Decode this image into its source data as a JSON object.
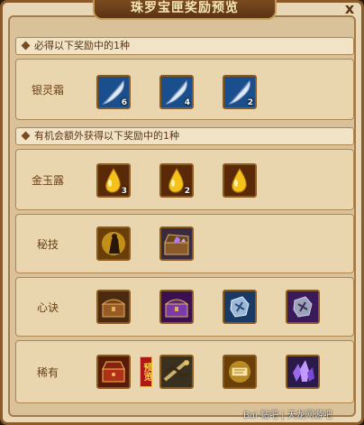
{
  "window": {
    "title": "珠罗宝匣奖励预览",
    "close_glyph": "x"
  },
  "sections": {
    "guaranteed": {
      "header": "必得以下奖励中的1种"
    },
    "bonus": {
      "header": "有机会额外获得以下奖励中的1种"
    }
  },
  "rows": {
    "yinlingshuang": {
      "label": "银灵霜",
      "items": [
        {
          "icon": "silver-feather-icon",
          "count": "6"
        },
        {
          "icon": "silver-feather-icon",
          "count": "4"
        },
        {
          "icon": "silver-feather-icon",
          "count": "2"
        }
      ]
    },
    "jinyulu": {
      "label": "金玉露",
      "items": [
        {
          "icon": "golden-drop-icon",
          "count": "3"
        },
        {
          "icon": "golden-drop-icon",
          "count": "2"
        },
        {
          "icon": "golden-drop-icon",
          "count": ""
        }
      ]
    },
    "miji": {
      "label": "秘技",
      "items": [
        {
          "icon": "golden-warrior-icon"
        },
        {
          "icon": "treasure-chest-icon"
        }
      ]
    },
    "xinjue": {
      "label": "心诀",
      "items": [
        {
          "icon": "brown-chest-icon"
        },
        {
          "icon": "purple-chest-icon"
        },
        {
          "icon": "blue-rune-icon"
        },
        {
          "icon": "purple-rune-icon"
        }
      ]
    },
    "xiyou": {
      "label": "稀有",
      "items": [
        {
          "icon": "red-chest-icon"
        },
        {
          "icon": "dragon-weapon-icon"
        },
        {
          "icon": "golden-scroll-icon"
        },
        {
          "icon": "purple-crystal-icon"
        }
      ],
      "preview_tag": "预览"
    }
  },
  "watermark": {
    "text": "Bai 贴吧 | 天龙网游吧"
  },
  "colors": {
    "panel_bg": "#e8d7b6",
    "border": "#8a5a2a",
    "label_text": "#6a3f15",
    "title_text": "#f6e6b5"
  }
}
